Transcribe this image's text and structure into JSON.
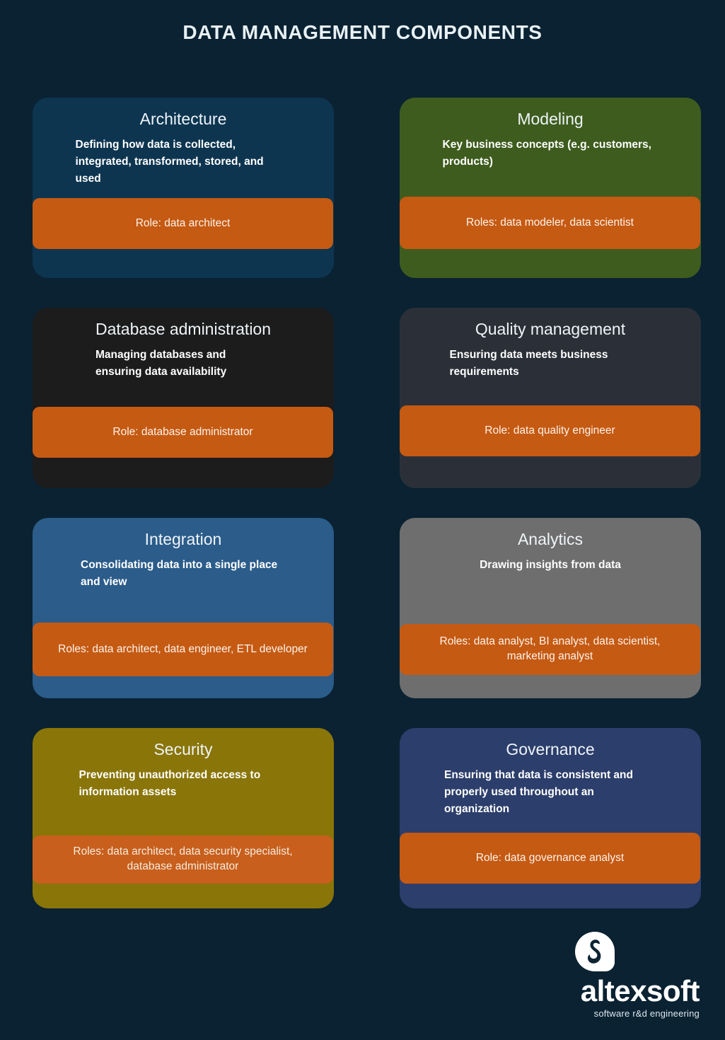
{
  "title": "DATA MANAGEMENT COMPONENTS",
  "theme": {
    "background": "#0a2232",
    "accent_orange": "#c55a13",
    "title_color": "#e9f1f6"
  },
  "cards": [
    {
      "id": "architecture",
      "title": "Architecture",
      "description": "Defining how data is collected, integrated, transformed, stored, and used",
      "role": "Role: data architect",
      "color": "#0d3550"
    },
    {
      "id": "modeling",
      "title": "Modeling",
      "description": "Key business concepts (e.g. customers, products)",
      "role": "Roles: data modeler, data scientist",
      "color": "#3e5c1e"
    },
    {
      "id": "database-administration",
      "title": "Database administration",
      "description": "Managing databases and ensuring data availability",
      "role": "Role: database administrator",
      "color": "#1c1c1c"
    },
    {
      "id": "quality-management",
      "title": "Quality management",
      "description": "Ensuring data meets business requirements",
      "role": "Role: data quality engineer",
      "color": "#2b3038"
    },
    {
      "id": "integration",
      "title": "Integration",
      "description": "Consolidating data into a single place and view",
      "role": "Roles: data architect, data engineer, ETL developer",
      "color": "#2b5c8a"
    },
    {
      "id": "analytics",
      "title": "Analytics",
      "description": "Drawing insights from data",
      "role": "Roles: data analyst, BI analyst, data scientist, marketing analyst",
      "color": "#6e6e6e"
    },
    {
      "id": "security",
      "title": "Security",
      "description": "Preventing unauthorized access to information assets",
      "role": "Roles: data architect, data security specialist, database administrator",
      "color": "#8a7508"
    },
    {
      "id": "governance",
      "title": "Governance",
      "description": "Ensuring that data is consistent and properly used throughout an organization",
      "role": "Role: data governance analyst",
      "color": "#2c3e6b"
    }
  ],
  "footer": {
    "brand": "altexsoft",
    "tagline": "software r&d engineering",
    "logo_icon": "altexsoft-speech-bubble-a-icon"
  }
}
